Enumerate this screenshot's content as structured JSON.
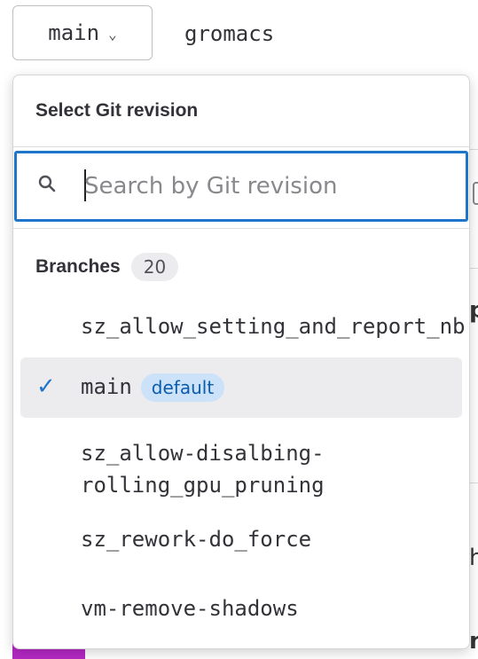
{
  "header": {
    "ref_selector_label": "main",
    "project_name": "gromacs"
  },
  "dropdown": {
    "title": "Select Git revision",
    "search": {
      "placeholder": "Search by Git revision",
      "value": ""
    },
    "branches": {
      "label": "Branches",
      "count": "20",
      "items": [
        {
          "label": "sz_allow_setting_and_report_nb",
          "selected": false
        },
        {
          "label": "main",
          "selected": true,
          "badge": "default"
        },
        {
          "label": "sz_allow-disalbing-\nrolling_gpu_pruning",
          "selected": false
        },
        {
          "label": "sz_rework-do_force",
          "selected": false
        },
        {
          "label": "vm-remove-shadows",
          "selected": false
        }
      ]
    }
  },
  "icons": {
    "chevron": "chevron-down-icon",
    "search": "search-icon",
    "check": "check-icon"
  },
  "colors": {
    "accent": "#1f75cb",
    "selected_bg": "#ececef",
    "badge_bg": "#cbe2f9",
    "badge_text": "#0b5cad"
  }
}
